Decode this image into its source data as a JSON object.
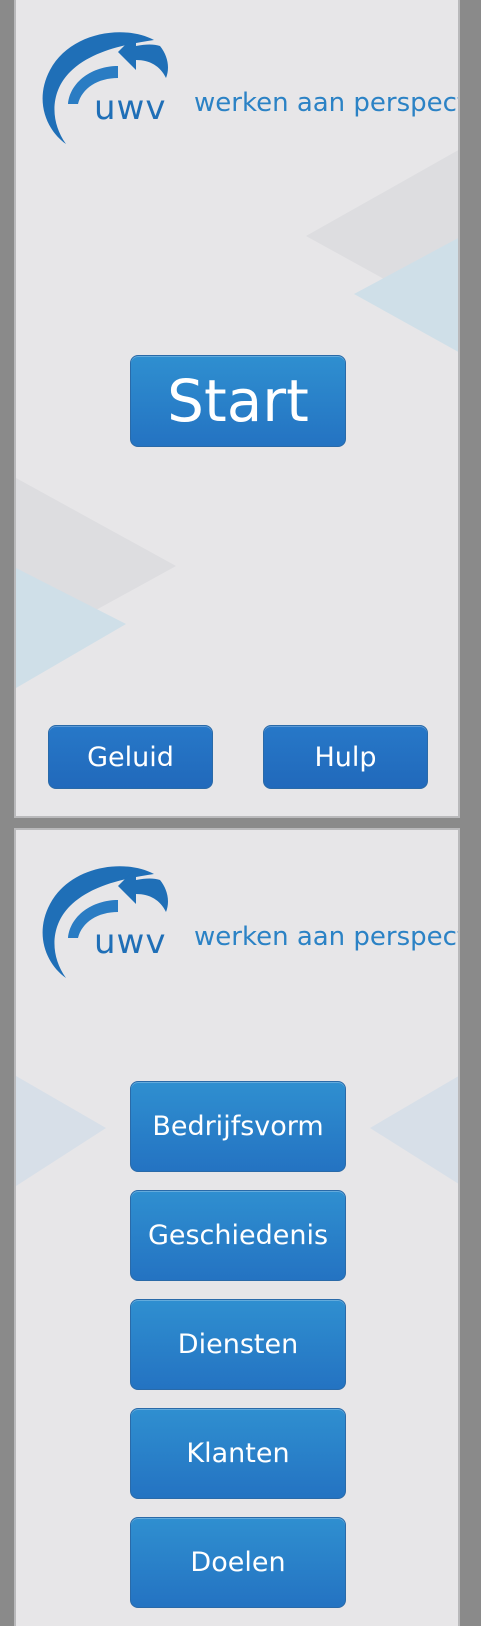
{
  "logo": {
    "brand": "uwv",
    "tagline": "werken aan perspectief"
  },
  "start_screen": {
    "start_label": "Start",
    "sound_label": "Geluid",
    "help_label": "Hulp"
  },
  "menu_screen": {
    "items": [
      {
        "label": "Bedrijfsvorm"
      },
      {
        "label": "Geschiedenis"
      },
      {
        "label": "Diensten"
      },
      {
        "label": "Klanten"
      },
      {
        "label": "Doelen"
      }
    ]
  },
  "colors": {
    "button": "#2473c2",
    "logo_blue": "#1f6fb7",
    "background": "#e7e6e8",
    "frame": "#8a8a8a"
  }
}
